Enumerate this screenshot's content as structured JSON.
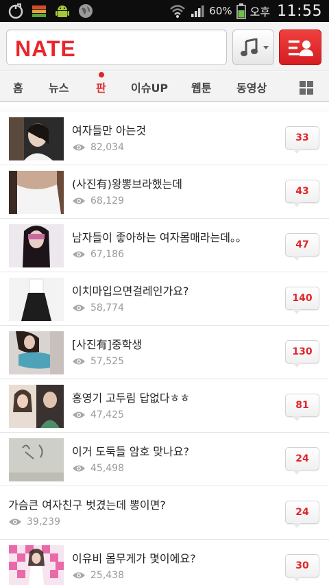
{
  "status_bar": {
    "battery_percent": "60%",
    "ampm": "오후",
    "time": "11:55",
    "icons": [
      "shazam-icon",
      "app-stack-icon",
      "android-icon",
      "globe-icon",
      "wifi-icon",
      "signal-icon",
      "battery-icon"
    ]
  },
  "header": {
    "logo": "NATE",
    "music_button": "music-icon",
    "menu_button": "user-menu-icon",
    "brand_color": "#e9252b"
  },
  "nav": {
    "tabs": [
      {
        "label": "홈",
        "active": false
      },
      {
        "label": "뉴스",
        "active": false
      },
      {
        "label": "판",
        "active": true
      },
      {
        "label": "이슈UP",
        "active": false
      },
      {
        "label": "웹툰",
        "active": false
      },
      {
        "label": "동영상",
        "active": false
      }
    ],
    "more_icon": "grid-icon"
  },
  "posts": [
    {
      "title": "여자들만 아는것",
      "views": "82,034",
      "comments": "33",
      "has_thumb": true
    },
    {
      "title": "(사진有)왕뽕브라했는데",
      "views": "68,129",
      "comments": "43",
      "has_thumb": true
    },
    {
      "title": "남자들이 좋아하는 여자몸매라는데。。",
      "views": "67,186",
      "comments": "47",
      "has_thumb": true
    },
    {
      "title": "이치마입으면걸레인가요?",
      "views": "58,774",
      "comments": "140",
      "has_thumb": true
    },
    {
      "title": "[사진有]중학생",
      "views": "57,525",
      "comments": "130",
      "has_thumb": true
    },
    {
      "title": "홍영기 고두림 답없다ㅎㅎ",
      "views": "47,425",
      "comments": "81",
      "has_thumb": true
    },
    {
      "title": "이거 도둑들 암호 맞나요?",
      "views": "45,498",
      "comments": "24",
      "has_thumb": true
    },
    {
      "title": "가슴큰 여자친구 벗겼는데 뽕이면?",
      "views": "39,239",
      "comments": "24",
      "has_thumb": false
    },
    {
      "title": "이유비 몸무게가 몇이에요?",
      "views": "25,438",
      "comments": "30",
      "has_thumb": true
    }
  ]
}
